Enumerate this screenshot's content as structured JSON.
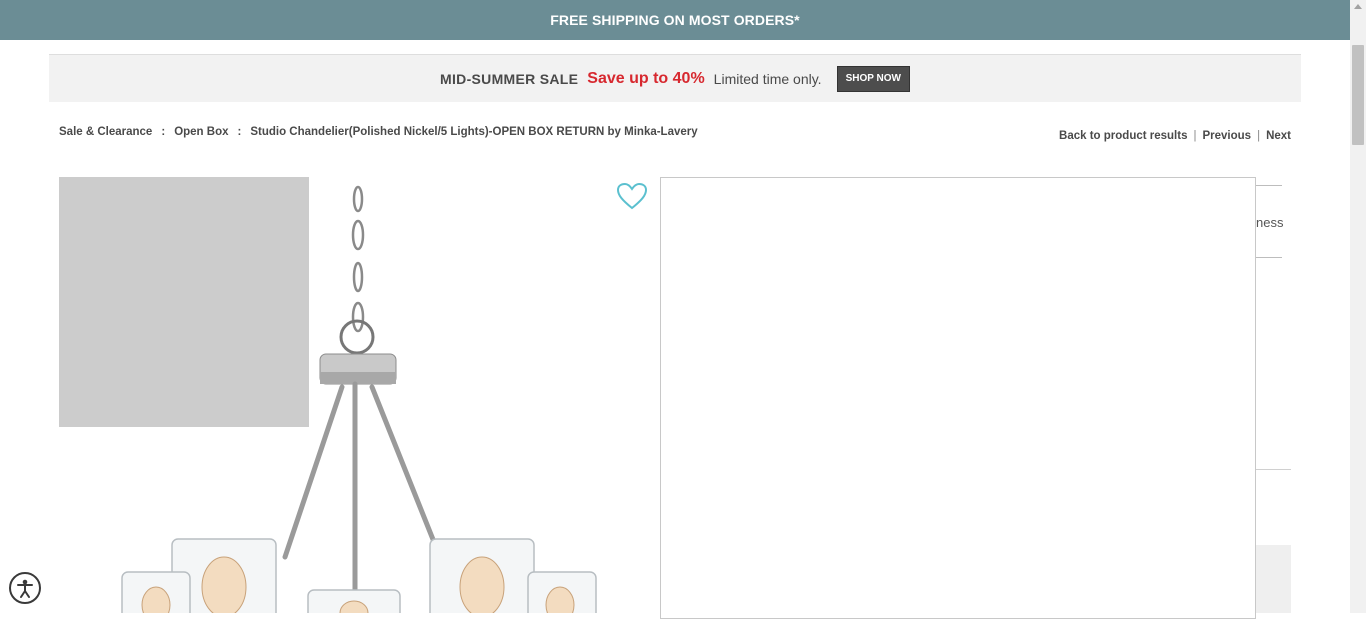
{
  "top_banner": {
    "text": "FREE SHIPPING ON MOST ORDERS*"
  },
  "sale_banner": {
    "title": "MID-SUMMER SALE",
    "highlight": "Save up to 40%",
    "note": "Limited time only.",
    "button_label": "SHOP NOW"
  },
  "breadcrumb": {
    "items": [
      "Sale & Clearance",
      "Open Box",
      "Studio Chandelier(Polished Nickel/5 Lights)-OPEN BOX RETURN by Minka-Lavery"
    ],
    "separator": ":"
  },
  "result_nav": {
    "back": "Back to product results",
    "previous": "Previous",
    "next": "Next",
    "divider": "|"
  },
  "side_panel": {
    "partial_text": "ness"
  },
  "icons": {
    "wishlist": "heart-icon",
    "accessibility": "accessibility-icon"
  },
  "colors": {
    "top_banner_bg": "#6b8d95",
    "sale_highlight": "#d7282f",
    "shop_button_bg": "#4d4d4d",
    "heart": "#5bc0cf"
  }
}
